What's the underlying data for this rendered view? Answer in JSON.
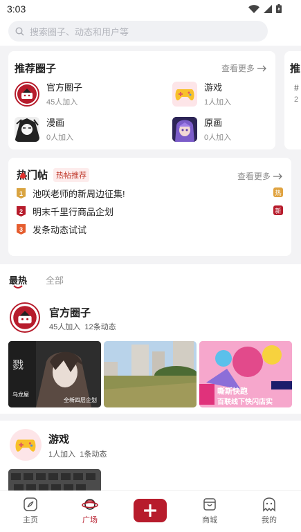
{
  "status": {
    "time": "3:03"
  },
  "search": {
    "placeholder": "搜索圈子、动态和用户等"
  },
  "recommend": {
    "title": "推荐圈子",
    "more": "查看更多",
    "items": [
      {
        "name": "官方圈子",
        "count": "45人加入"
      },
      {
        "name": "游戏",
        "count": "1人加入"
      },
      {
        "name": "漫画",
        "count": "0人加入"
      },
      {
        "name": "原画",
        "count": "0人加入"
      }
    ],
    "peek_title": "推",
    "peek_line1": "#",
    "peek_line2": "2"
  },
  "hot": {
    "title": "热门帖",
    "badge": "热帖推荐",
    "more": "查看更多",
    "items": [
      {
        "rank": "1",
        "text": "池咲老师的新周边征集!",
        "tag": "热"
      },
      {
        "rank": "2",
        "text": "明末千里行商品企划",
        "tag": "新"
      },
      {
        "rank": "3",
        "text": "发条动态试试",
        "tag": ""
      }
    ]
  },
  "tabs": {
    "active": "最热",
    "other": "全部"
  },
  "feed": [
    {
      "name": "官方圈子",
      "meta": "45人加入  12条动态",
      "img1_text": "全新四层企划",
      "img3_text1": "嘶斯快跑",
      "img3_text2": "百联线下快闪店实"
    },
    {
      "name": "游戏",
      "meta": "1人加入  1条动态"
    }
  ],
  "nav": {
    "home": "主页",
    "square": "广场",
    "mall": "商城",
    "mine": "我的"
  },
  "colors": {
    "accent": "#b71c2c",
    "gold": "#d9a441",
    "orange": "#e55d2f"
  }
}
